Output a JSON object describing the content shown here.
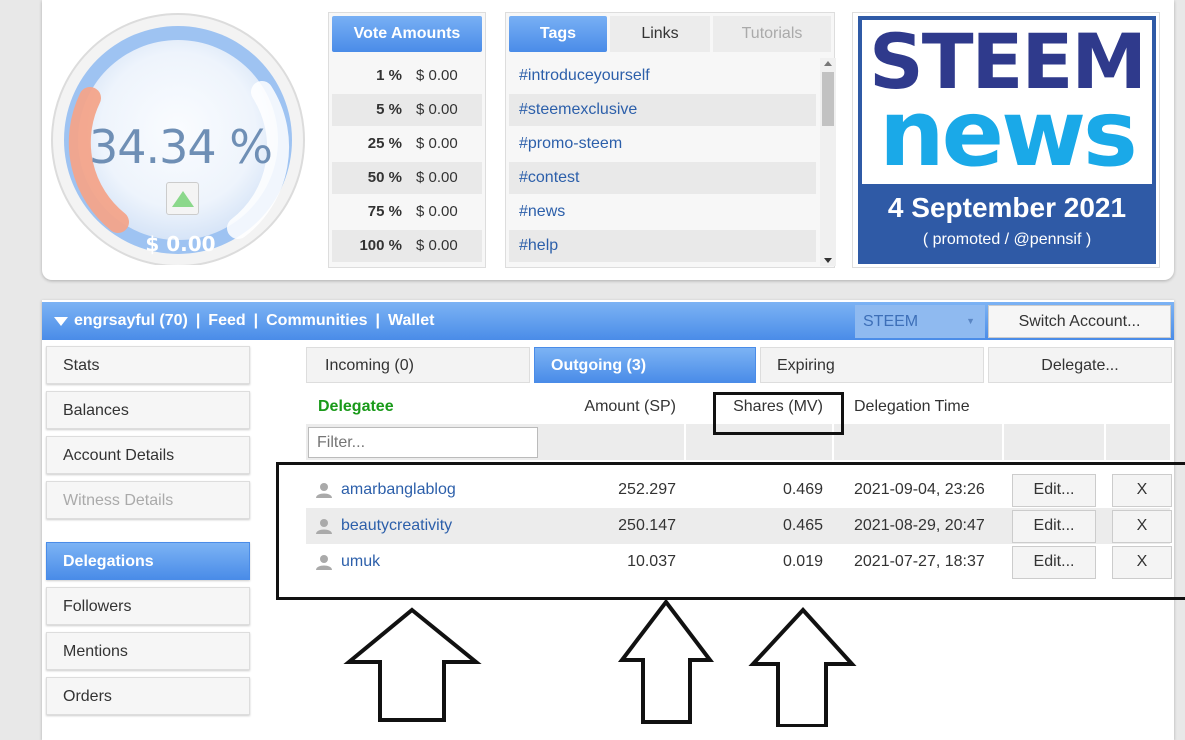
{
  "voting_power": {
    "percent": "34.34 %",
    "value": "$ 0.00",
    "arrow_color": "#8bd88b"
  },
  "vote_amounts": {
    "title": "Vote Amounts",
    "rows": [
      {
        "pct": "1 %",
        "val": "$ 0.00"
      },
      {
        "pct": "5 %",
        "val": "$ 0.00"
      },
      {
        "pct": "25 %",
        "val": "$ 0.00"
      },
      {
        "pct": "50 %",
        "val": "$ 0.00"
      },
      {
        "pct": "75 %",
        "val": "$ 0.00"
      },
      {
        "pct": "100 %",
        "val": "$ 0.00"
      }
    ]
  },
  "tags_panel": {
    "tabs": [
      "Tags",
      "Links",
      "Tutorials"
    ],
    "tags": [
      "#introduceyourself",
      "#steemexclusive",
      "#promo-steem",
      "#contest",
      "#news",
      "#help"
    ]
  },
  "news_banner": {
    "line1": "STEEM",
    "line2": "news",
    "date": "4 September 2021",
    "credit": "( promoted / @pennsif )"
  },
  "account_bar": {
    "account": "engrsayful (70)",
    "links": [
      "Feed",
      "Communities",
      "Wallet"
    ],
    "separator": "|",
    "currency": "STEEM",
    "switch_label": "Switch Account..."
  },
  "side_menu": [
    "Stats",
    "Balances",
    "Account Details",
    "Witness Details",
    "Delegations",
    "Followers",
    "Mentions",
    "Orders"
  ],
  "delegation_tabs": [
    "Incoming (0)",
    "Outgoing (3)",
    "Expiring",
    "Delegate..."
  ],
  "table": {
    "headers": {
      "delegatee": "Delegatee",
      "amount": "Amount (SP)",
      "shares": "Shares (MV)",
      "time": "Delegation Time"
    },
    "filter_placeholder": "Filter...",
    "rows": [
      {
        "name": "amarbanglablog",
        "amount": "252.297",
        "shares": "0.469",
        "time": "2021-09-04, 23:26",
        "edit": "Edit...",
        "del": "X"
      },
      {
        "name": "beautycreativity",
        "amount": "250.147",
        "shares": "0.465",
        "time": "2021-08-29, 20:47",
        "edit": "Edit...",
        "del": "X"
      },
      {
        "name": "umuk",
        "amount": "10.037",
        "shares": "0.019",
        "time": "2021-07-27, 18:37",
        "edit": "Edit...",
        "del": "X"
      }
    ]
  },
  "colors": {
    "accent_blue": "#4a8ce8",
    "link_blue": "#2c5faa",
    "header_green": "#1a9a1a"
  }
}
